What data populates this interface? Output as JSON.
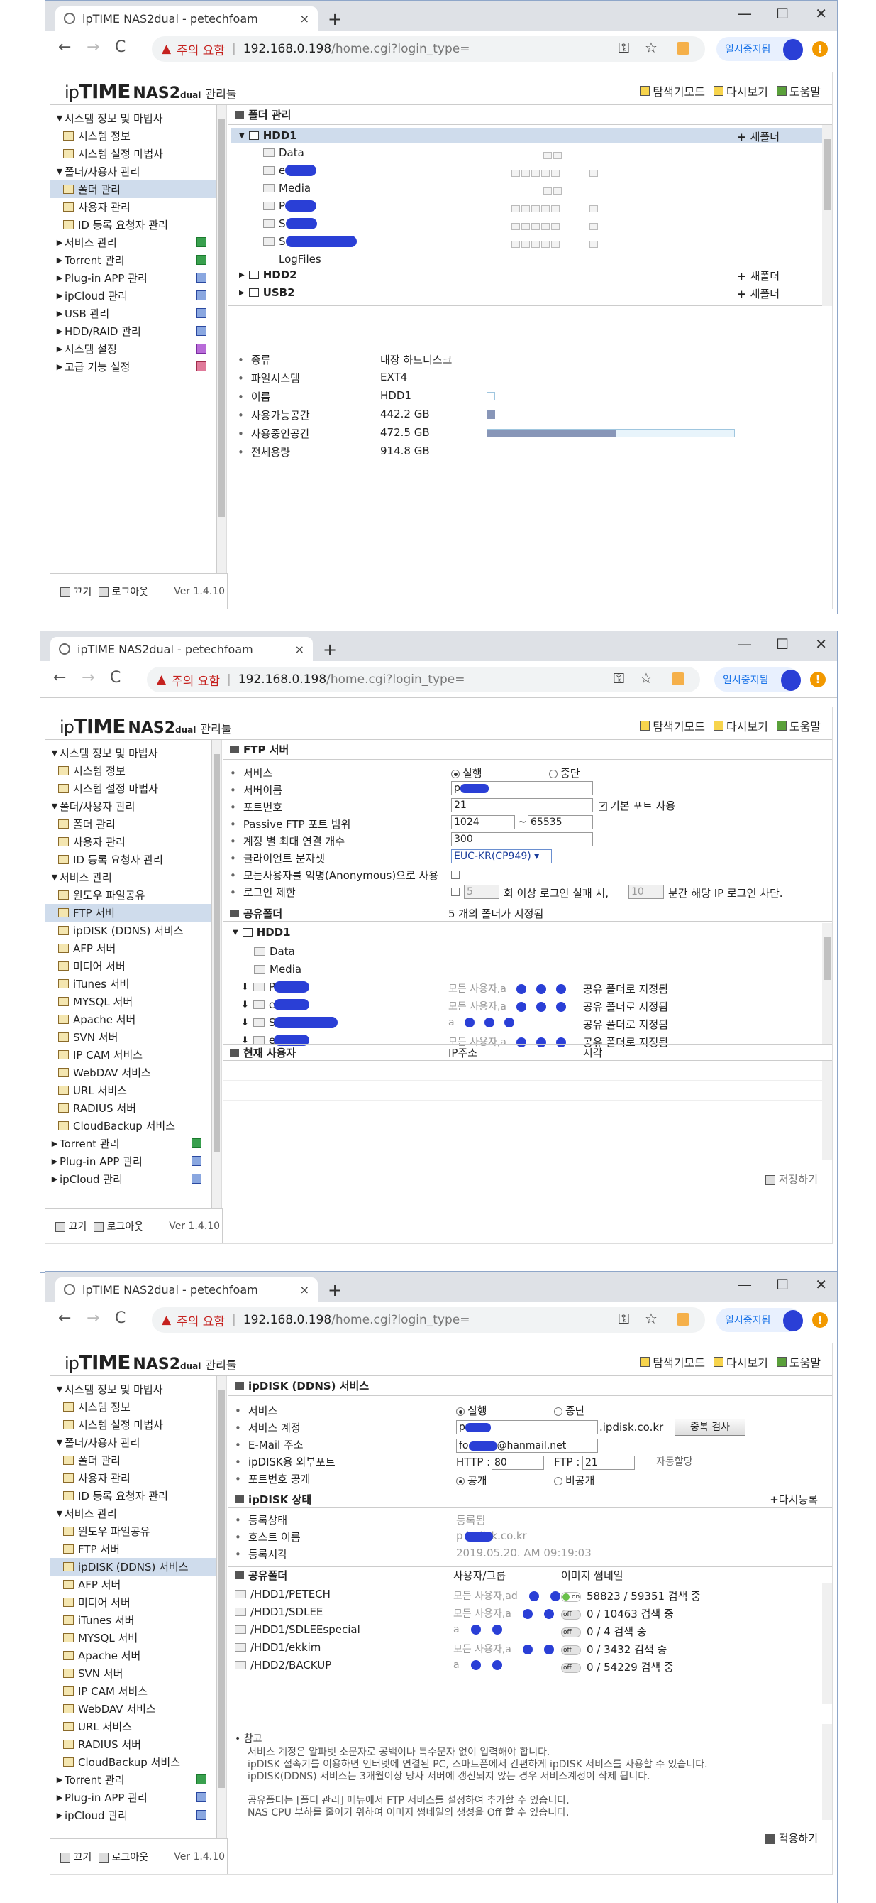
{
  "browser": {
    "tab_title": "ipTIME NAS2dual - petechfoam",
    "tab_close": "×",
    "new_tab": "+",
    "win_min": "—",
    "win_max": "☐",
    "win_close": "✕",
    "back": "←",
    "forward": "→",
    "reload": "C",
    "warning_icon": "▲",
    "warning_text": "주의 요함",
    "separator": "|",
    "url_host": "192.168.0.198",
    "url_path": "/home.cgi?login_type=",
    "key_icon": "⚿",
    "star_icon": "☆",
    "paused_label": "일시중지됨",
    "menu_dot": "!"
  },
  "app": {
    "logo_ip": "ip",
    "logo_time": "TIME",
    "logo_nas": "NAS2",
    "logo_dual": "dual",
    "logo_mgr": "관리툴",
    "toplinks": [
      "탐색기모드",
      "다시보기",
      "도움말"
    ],
    "footer": {
      "off": "끄기",
      "logout": "로그아웃",
      "version": "Ver 1.4.10"
    }
  },
  "shot1": {
    "sidebar": [
      {
        "label": "시스템 정보 및 마법사",
        "tri": "▼",
        "level": 0
      },
      {
        "label": "시스템 정보",
        "level": 1
      },
      {
        "label": "시스템 설정 마법사",
        "level": 1
      },
      {
        "label": "폴더/사용자 관리",
        "tri": "▼",
        "level": 0
      },
      {
        "label": "폴더 관리",
        "level": 1,
        "sel": true
      },
      {
        "label": "사용자 관리",
        "level": 1
      },
      {
        "label": "ID 등록 요청자 관리",
        "level": 1
      },
      {
        "label": "서비스 관리",
        "tri": "▶",
        "level": 0,
        "badge": "g"
      },
      {
        "label": "Torrent 관리",
        "tri": "▶",
        "level": 0,
        "badge": "g"
      },
      {
        "label": "Plug-in APP 관리",
        "tri": "▶",
        "level": 0,
        "badge": "b"
      },
      {
        "label": "ipCloud 관리",
        "tri": "▶",
        "level": 0,
        "badge": "b"
      },
      {
        "label": "USB 관리",
        "tri": "▶",
        "level": 0,
        "badge": "b"
      },
      {
        "label": "HDD/RAID 관리",
        "tri": "▶",
        "level": 0,
        "badge": "b"
      },
      {
        "label": "시스템 설정",
        "tri": "▶",
        "level": 0,
        "badge": "p"
      },
      {
        "label": "고급 기능 설정",
        "tri": "▶",
        "level": 0,
        "badge": "r"
      }
    ],
    "section_title": "폴더 관리",
    "hdd1": "HDD1",
    "new_folder": "새폴더",
    "folders": [
      "Data",
      "e",
      "Media",
      "P",
      "S",
      "S",
      "LogFiles"
    ],
    "hdd2": "HDD2",
    "usb2": "USB2",
    "info_labels": [
      "종류",
      "파일시스템",
      "이름",
      "사용가능공간",
      "사용중인공간",
      "전체용량"
    ],
    "info_values": [
      "내장 하드디스크",
      "EXT4",
      "HDD1",
      "442.2 GB",
      "472.5 GB",
      "914.8 GB"
    ],
    "usage_fraction": 0.52
  },
  "shot2": {
    "sidebar": [
      {
        "label": "시스템 정보 및 마법사",
        "tri": "▼",
        "level": 0
      },
      {
        "label": "시스템 정보",
        "level": 1
      },
      {
        "label": "시스템 설정 마법사",
        "level": 1
      },
      {
        "label": "폴더/사용자 관리",
        "tri": "▼",
        "level": 0
      },
      {
        "label": "폴더 관리",
        "level": 1
      },
      {
        "label": "사용자 관리",
        "level": 1
      },
      {
        "label": "ID 등록 요청자 관리",
        "level": 1
      },
      {
        "label": "서비스 관리",
        "tri": "▼",
        "level": 0
      },
      {
        "label": "윈도우 파일공유",
        "level": 1
      },
      {
        "label": "FTP 서버",
        "level": 1,
        "sel": true
      },
      {
        "label": "ipDISK (DDNS) 서비스",
        "level": 1
      },
      {
        "label": "AFP 서버",
        "level": 1
      },
      {
        "label": "미디어 서버",
        "level": 1
      },
      {
        "label": "iTunes 서버",
        "level": 1
      },
      {
        "label": "MYSQL 서버",
        "level": 1
      },
      {
        "label": "Apache 서버",
        "level": 1
      },
      {
        "label": "SVN 서버",
        "level": 1
      },
      {
        "label": "IP CAM 서비스",
        "level": 1
      },
      {
        "label": "WebDAV 서비스",
        "level": 1
      },
      {
        "label": "URL 서비스",
        "level": 1
      },
      {
        "label": "RADIUS 서버",
        "level": 1
      },
      {
        "label": "CloudBackup 서비스",
        "level": 1
      },
      {
        "label": "Torrent 관리",
        "tri": "▶",
        "level": 0,
        "badge": "g"
      },
      {
        "label": "Plug-in APP 관리",
        "tri": "▶",
        "level": 0,
        "badge": "b"
      },
      {
        "label": "ipCloud 관리",
        "tri": "▶",
        "level": 0,
        "badge": "b"
      }
    ],
    "section_title": "FTP 서버",
    "form_labels": [
      "서비스",
      "서버이름",
      "포트번호",
      "Passive FTP 포트 범위",
      "계정 별 최대 연결 개수",
      "클라이언트 문자셋",
      "모든사용자를 익명(Anonymous)으로 사용",
      "로그인 제한"
    ],
    "run": "실행",
    "stop": "중단",
    "server_name": "p",
    "port": "21",
    "default_port": "기본 포트 사용",
    "passive_from": "1024",
    "passive_tilde": "~",
    "passive_to": "65535",
    "max_conn": "300",
    "charset": "EUC-KR(CP949) ▾",
    "login_fail_count": "5",
    "login_text_a": "회 이상 로그인 실패 시,",
    "login_minutes": "10",
    "login_text_b": "분간 해당 IP 로그인 차단.",
    "shared_title": "공유폴더",
    "shared_count": "5 개의 폴더가 지정됨",
    "shared_rows": [
      {
        "name": "Data",
        "users": "",
        "status": ""
      },
      {
        "name": "Media",
        "users": "",
        "status": ""
      },
      {
        "name": "P",
        "users": "모든 사용자,a",
        "status": "공유 폴더로 지정됨"
      },
      {
        "name": "e",
        "users": "모든 사용자,a",
        "status": "공유 폴더로 지정됨"
      },
      {
        "name": "S",
        "users": "a",
        "status": "공유 폴더로 지정됨"
      },
      {
        "name": "e",
        "users": "모든 사용자,a",
        "status": "공유 폴더로 지정됨"
      }
    ],
    "cur_user_title": "현재 사용자",
    "col_ip": "IP주소",
    "col_time": "시각",
    "save": "저장하기"
  },
  "shot3": {
    "sidebar": [
      {
        "label": "시스템 정보 및 마법사",
        "tri": "▼",
        "level": 0
      },
      {
        "label": "시스템 정보",
        "level": 1
      },
      {
        "label": "시스템 설정 마법사",
        "level": 1
      },
      {
        "label": "폴더/사용자 관리",
        "tri": "▼",
        "level": 0
      },
      {
        "label": "폴더 관리",
        "level": 1
      },
      {
        "label": "사용자 관리",
        "level": 1
      },
      {
        "label": "ID 등록 요청자 관리",
        "level": 1
      },
      {
        "label": "서비스 관리",
        "tri": "▼",
        "level": 0
      },
      {
        "label": "윈도우 파일공유",
        "level": 1
      },
      {
        "label": "FTP 서버",
        "level": 1
      },
      {
        "label": "ipDISK (DDNS) 서비스",
        "level": 1,
        "sel": true
      },
      {
        "label": "AFP 서버",
        "level": 1
      },
      {
        "label": "미디어 서버",
        "level": 1
      },
      {
        "label": "iTunes 서버",
        "level": 1
      },
      {
        "label": "MYSQL 서버",
        "level": 1
      },
      {
        "label": "Apache 서버",
        "level": 1
      },
      {
        "label": "SVN 서버",
        "level": 1
      },
      {
        "label": "IP CAM 서비스",
        "level": 1
      },
      {
        "label": "WebDAV 서비스",
        "level": 1
      },
      {
        "label": "URL 서비스",
        "level": 1
      },
      {
        "label": "RADIUS 서버",
        "level": 1
      },
      {
        "label": "CloudBackup 서비스",
        "level": 1
      },
      {
        "label": "Torrent 관리",
        "tri": "▶",
        "level": 0,
        "badge": "g"
      },
      {
        "label": "Plug-in APP 관리",
        "tri": "▶",
        "level": 0,
        "badge": "b"
      },
      {
        "label": "ipCloud 관리",
        "tri": "▶",
        "level": 0,
        "badge": "b"
      }
    ],
    "section_title": "ipDISK (DDNS) 서비스",
    "form_labels": [
      "서비스",
      "서비스 계정",
      "E-Mail 주소",
      "ipDISK용 외부포트",
      "포트번호 공개"
    ],
    "run": "실행",
    "stop": "중단",
    "account": "p",
    "account_suffix": ".ipdisk.co.kr",
    "dup_check": "중복 검사",
    "email_a": "fo",
    "email_b": "@hanmail.net",
    "http_label": "HTTP :",
    "http_port": "80",
    "ftp_label": "FTP :",
    "ftp_port": "21",
    "auto_assign": "자동할당",
    "public": "공개",
    "private": "비공개",
    "status_title": "ipDISK 상태",
    "re_register": "다시등록",
    "status_labels": [
      "등록상태",
      "호스트 이름",
      "등록시각"
    ],
    "status_values": [
      "등록됨",
      "p        ipdisk.co.kr",
      "2019.05.20. AM 09:19:03"
    ],
    "shared_title": "공유폴더",
    "col_user_group": "사용자/그룹",
    "col_thumb": "이미지 썸네일",
    "shared_rows": [
      {
        "path": "/HDD1/PETECH",
        "users": "모든 사용자,ad",
        "toggle": "on",
        "thumb": "58823 / 59351 검색 중"
      },
      {
        "path": "/HDD1/SDLEE",
        "users": "모든 사용자,a",
        "toggle": "off",
        "thumb": "0 / 10463 검색 중"
      },
      {
        "path": "/HDD1/SDLEEspecial",
        "users": "a",
        "toggle": "off",
        "thumb": "0 / 4 검색 중"
      },
      {
        "path": "/HDD1/ekkim",
        "users": "모든 사용자,a",
        "toggle": "off",
        "thumb": "0 / 3432 검색 중"
      },
      {
        "path": "/HDD2/BACKUP",
        "users": "a",
        "toggle": "off",
        "thumb": "0 / 54229 검색 중"
      }
    ],
    "note_title": "참고",
    "notes": [
      "서비스 계정은 알파벳 소문자로 공백이나 특수문자 없이 입력해야 합니다.",
      "ipDISK 접속기를 이용하면 인터넷에 연결된 PC, 스마트폰에서 간편하게 ipDISK 서비스를 사용할 수 있습니다.",
      "ipDISK(DDNS) 서비스는 3개월이상 당사 서버에 갱신되지 않는 경우 서비스계정이 삭제 됩니다.",
      "공유폴더는 [폴더 관리] 메뉴에서 FTP 서비스를 설정하여 추가할 수 있습니다.",
      "NAS CPU 부하를 줄이기 위하여 이미지 썸네일의 생성을 Off 할 수 있습니다."
    ],
    "apply": "적용하기"
  }
}
